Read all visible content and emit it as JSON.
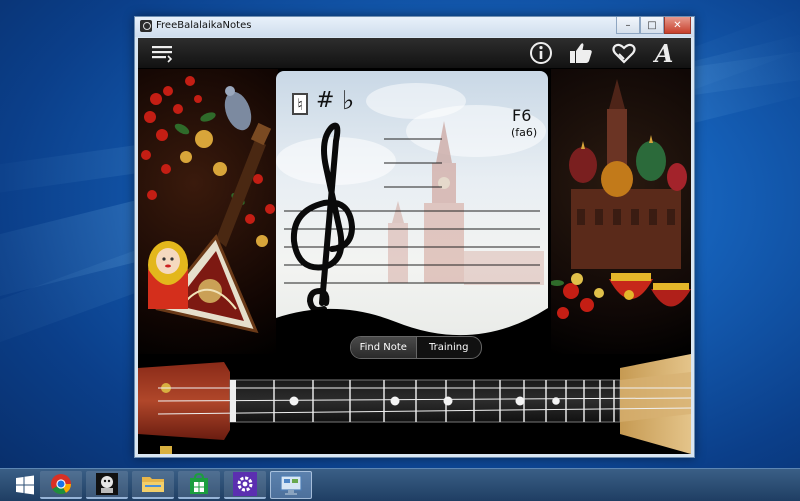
{
  "window": {
    "title": "FreeBalalaikaNotes",
    "controls": {
      "minimize": "–",
      "maximize": "□",
      "close": "✕"
    }
  },
  "toolbar": {
    "icons": [
      "menu-icon",
      "info-icon",
      "thumbs-up-icon",
      "heart-icon",
      "font-icon"
    ],
    "font_glyph": "A"
  },
  "sheet": {
    "tools": {
      "natural": "♮",
      "sharp": "#",
      "flat": "♭"
    },
    "note": "F6",
    "solfege": "(fa6)"
  },
  "mode_switch": {
    "options": [
      "Find Note",
      "Training"
    ],
    "selected": "Find Note"
  },
  "taskbar": {
    "items": [
      {
        "icon": "start-icon",
        "state": "normal"
      },
      {
        "icon": "chrome-icon",
        "state": "open"
      },
      {
        "icon": "app-mascot-icon",
        "state": "open"
      },
      {
        "icon": "file-explorer-icon",
        "state": "open"
      },
      {
        "icon": "store-icon",
        "state": "open"
      },
      {
        "icon": "settings-icon",
        "state": "open"
      },
      {
        "icon": "control-panel-icon",
        "state": "active"
      }
    ]
  },
  "colors": {
    "desktop": "#1560b8",
    "taskbar": "#2a4a72",
    "close_button": "#c7402c",
    "app_background": "#000000"
  }
}
